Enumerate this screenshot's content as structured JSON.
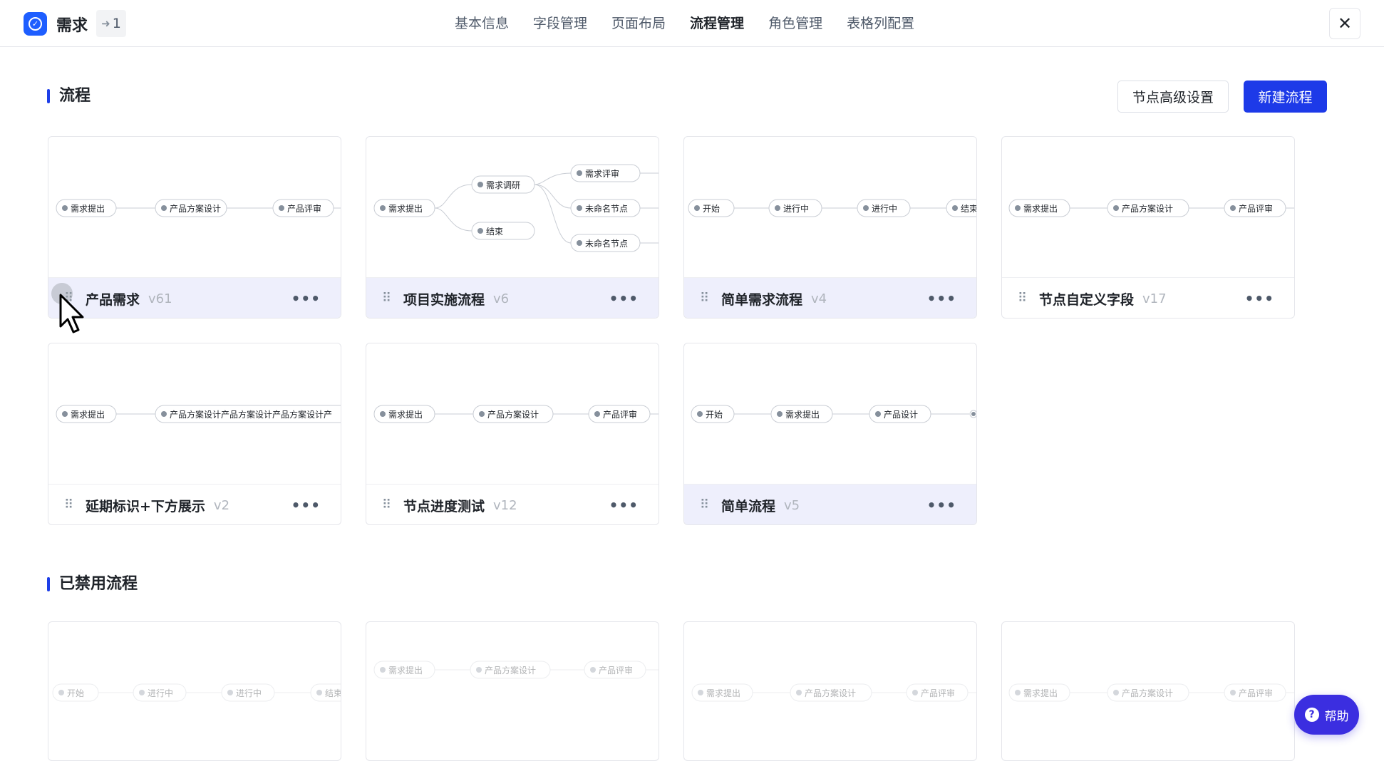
{
  "header": {
    "app_title": "需求",
    "share_count": "1",
    "tabs": [
      {
        "label": "基本信息",
        "active": false
      },
      {
        "label": "字段管理",
        "active": false
      },
      {
        "label": "页面布局",
        "active": false
      },
      {
        "label": "流程管理",
        "active": true
      },
      {
        "label": "角色管理",
        "active": false
      },
      {
        "label": "表格列配置",
        "active": false
      }
    ],
    "close_icon": "close-icon"
  },
  "flows_section": {
    "title": "流程",
    "advanced_button": "节点高级设置",
    "new_button": "新建流程",
    "cards": [
      {
        "name": "产品需求",
        "version": "v61",
        "nodes": [
          "需求提出",
          "产品方案设计",
          "产品评审"
        ]
      },
      {
        "name": "项目实施流程",
        "version": "v6",
        "nodes": [
          "需求提出",
          "需求调研",
          "结束",
          "需求评审",
          "未命名节点",
          "未命名节点"
        ]
      },
      {
        "name": "简单需求流程",
        "version": "v4",
        "nodes": [
          "开始",
          "进行中",
          "进行中",
          "结束"
        ]
      },
      {
        "name": "节点自定义字段",
        "version": "v17",
        "nodes": [
          "需求提出",
          "产品方案设计",
          "产品评审"
        ]
      },
      {
        "name": "延期标识+下方展示",
        "version": "v2",
        "nodes": [
          "需求提出",
          "产品方案设计产品方案设计产品方案设计产"
        ]
      },
      {
        "name": "节点进度测试",
        "version": "v12",
        "nodes": [
          "需求提出",
          "产品方案设计",
          "产品评审"
        ]
      },
      {
        "name": "简单流程",
        "version": "v5",
        "nodes": [
          "开始",
          "需求提出",
          "产品设计"
        ]
      }
    ]
  },
  "disabled_section": {
    "title": "已禁用流程",
    "cards": [
      {
        "nodes": [
          "开始",
          "进行中",
          "进行中",
          "结束"
        ]
      },
      {
        "nodes": [
          "需求提出",
          "产品方案设计",
          "产品评审"
        ]
      },
      {
        "nodes": [
          "需求提出",
          "产品方案设计",
          "产品评审"
        ]
      },
      {
        "nodes": [
          "需求提出",
          "产品方案设计",
          "产品评审"
        ]
      }
    ]
  },
  "help": {
    "label": "帮助"
  },
  "colors": {
    "primary": "#1d3ae8",
    "highlight_footer": "#eeeffc",
    "help": "#3b2ee0"
  }
}
